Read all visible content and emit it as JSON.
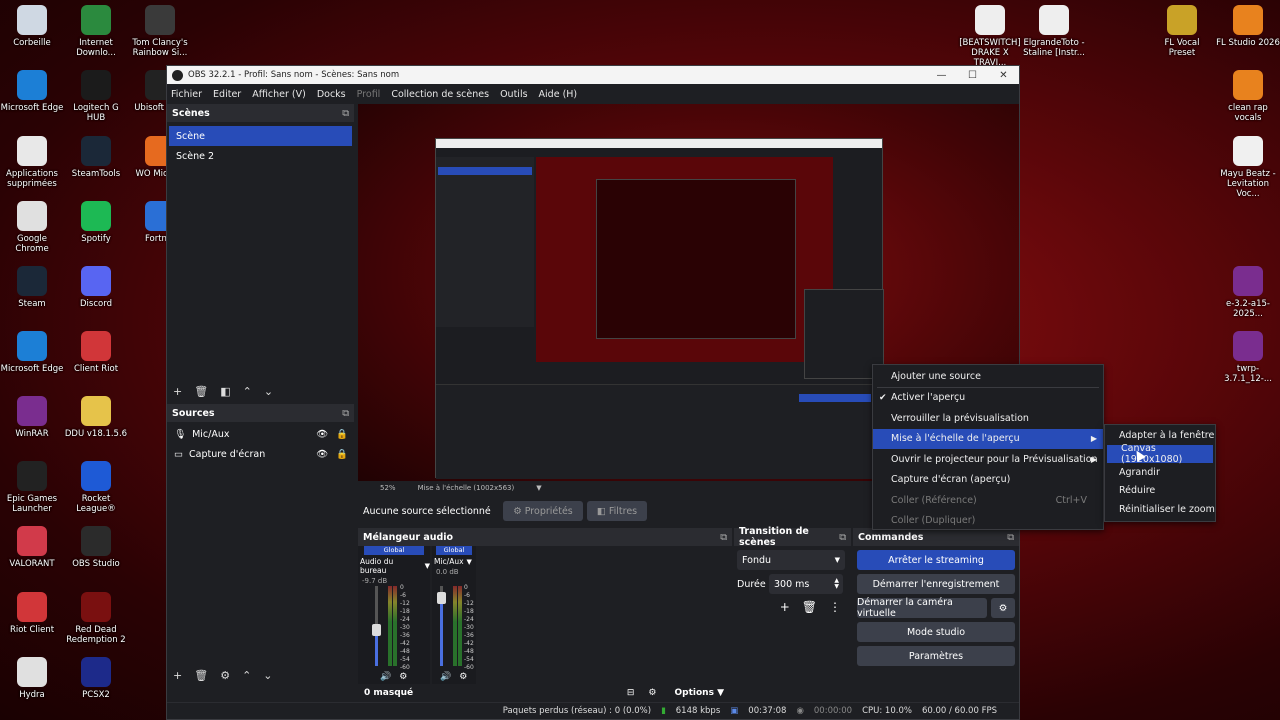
{
  "desktop": {
    "left_icons": [
      {
        "label": "Corbeille"
      },
      {
        "label": "Internet Downlo..."
      },
      {
        "label": "Tom Clancy's Rainbow Si..."
      },
      {
        "label": "Microsoft Edge"
      },
      {
        "label": "Logitech G HUB"
      },
      {
        "label": "Ubisoft Co..."
      },
      {
        "label": "Applications supprimées"
      },
      {
        "label": "SteamTools"
      },
      {
        "label": "WO Mic C..."
      },
      {
        "label": "Google Chrome"
      },
      {
        "label": "Spotify"
      },
      {
        "label": "Fortn..."
      },
      {
        "label": "Steam"
      },
      {
        "label": "Discord"
      },
      {
        "label": "Microsoft Edge"
      },
      {
        "label": "Client Riot"
      },
      {
        "label": "WinRAR"
      },
      {
        "label": "DDU v18.1.5.6"
      },
      {
        "label": "Epic Games Launcher"
      },
      {
        "label": "Rocket League®"
      },
      {
        "label": "VALORANT"
      },
      {
        "label": "OBS Studio"
      },
      {
        "label": "Riot Client"
      },
      {
        "label": "Red Dead Redemption 2"
      },
      {
        "label": "Hydra"
      },
      {
        "label": "PCSX2"
      }
    ],
    "right_icons": [
      {
        "label": "[BEATSWITCH] DRAKE X TRAVI..."
      },
      {
        "label": "ElgrandeToto - Staline [Instr..."
      },
      {
        "label": "FL Vocal Preset"
      },
      {
        "label": "FL Studio 2026"
      },
      {
        "label": "clean rap vocals"
      },
      {
        "label": "Mayu Beatz - Levitation Voc..."
      },
      {
        "label": "e-3.2-a15-2025..."
      },
      {
        "label": "twrp-3.7.1_12-..."
      }
    ]
  },
  "window": {
    "title": "OBS 32.2.1 - Profil: Sans nom - Scènes: Sans nom",
    "minimize": "—",
    "maximize": "☐",
    "close": "✕"
  },
  "menubar": [
    "Fichier",
    "Editer",
    "Afficher (V)",
    "Docks",
    "Profil",
    "Collection de scènes",
    "Outils",
    "Aide (H)"
  ],
  "scenes": {
    "title": "Scènes",
    "items": [
      "Scène",
      "Scène 2"
    ],
    "selected": "Scène"
  },
  "sources": {
    "title": "Sources",
    "items": [
      "Mic/Aux",
      "Capture d'écran"
    ]
  },
  "preview": {
    "zoom": "52%",
    "scale_mode": "Mise à l'échelle (1002x563)"
  },
  "properties_bar": {
    "no_source": "Aucune source sélectionné",
    "properties": "Propriétés",
    "filters": "Filtres"
  },
  "mixer": {
    "title": "Mélangeur audio",
    "channels": [
      {
        "badge": "Global",
        "name": "Audio du bureau",
        "db": "-9.7 dB",
        "level": 0.45
      },
      {
        "badge": "Global",
        "name": "Mic/Aux",
        "db": "0.0 dB",
        "level": 0.85
      }
    ],
    "scale": [
      "0",
      "-6",
      "-12",
      "-18",
      "-24",
      "-30",
      "-36",
      "-42",
      "-48",
      "-54",
      "-60"
    ],
    "hidden": "0 masqué",
    "options": "Options"
  },
  "transition": {
    "title": "Transition de scènes",
    "type": "Fondu",
    "duration_label": "Durée",
    "duration": "300 ms"
  },
  "controls": {
    "title": "Commandes",
    "stop_stream": "Arrêter le streaming",
    "start_record": "Démarrer l'enregistrement",
    "start_vcam": "Démarrer la caméra virtuelle",
    "studio_mode": "Mode studio",
    "settings": "Paramètres"
  },
  "statusbar": {
    "dropped": "Paquets perdus (réseau) : 0 (0.0%)",
    "bitrate": "6148 kbps",
    "stream_time": "00:37:08",
    "rec_time": "00:00:00",
    "cpu": "CPU: 10.0%",
    "fps": "60.00 / 60.00 FPS"
  },
  "context_menu": {
    "items": [
      {
        "label": "Ajouter une source"
      },
      {
        "label": "Activer l'aperçu",
        "checked": "✔"
      },
      {
        "label": "Verrouiller la prévisualisation"
      },
      {
        "label": "Mise à l'échelle de l'aperçu",
        "arrow": "▶"
      },
      {
        "label": "Ouvrir le projecteur pour la Prévisualisation",
        "arrow": "▶"
      },
      {
        "label": "Capture d'écran (aperçu)"
      },
      {
        "label": "Coller (Référence)",
        "shortcut": "Ctrl+V"
      },
      {
        "label": "Coller (Dupliquer)"
      }
    ]
  },
  "submenu": {
    "items": [
      "Adapter à la fenêtre",
      "Canvas (1920x1080)",
      "Agrandir",
      "Réduire",
      "Réinitialiser le zoom"
    ]
  },
  "colors": {
    "accent": "#284cb8",
    "panel": "#1e1f23",
    "dock_title": "#2b2c31",
    "button": "#3c404b"
  }
}
